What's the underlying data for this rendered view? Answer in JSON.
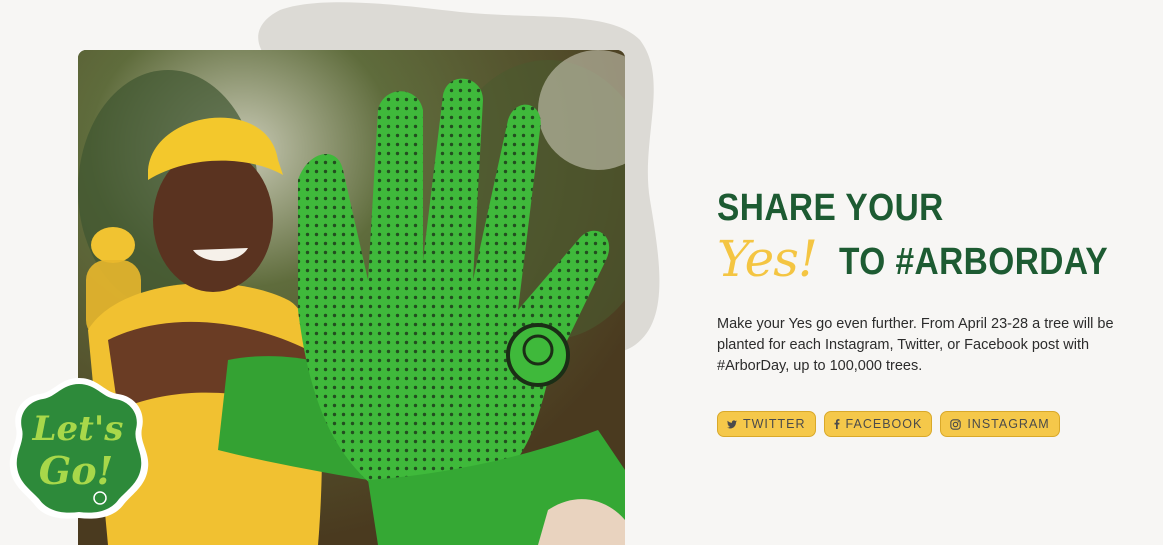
{
  "headline": {
    "line1": "SHARE YOUR",
    "yes": "Yes!",
    "line2": "TO #ARBORDAY"
  },
  "description": "Make your Yes go even further. From April 23-28 a tree will be planted for each Instagram, Twitter, or Facebook post with #ArborDay, up to 100,000 trees.",
  "socials": [
    {
      "label": "TWITTER",
      "icon": "twitter-icon"
    },
    {
      "label": "FACEBOOK",
      "icon": "facebook-icon"
    },
    {
      "label": "INSTAGRAM",
      "icon": "instagram-icon"
    }
  ],
  "badge": {
    "text1": "Let's",
    "text2": "Go!"
  },
  "colors": {
    "brand_green": "#1d5b32",
    "accent_yellow": "#f4c542",
    "button_yellow": "#f5c84a",
    "glove_green": "#3cb83a"
  }
}
